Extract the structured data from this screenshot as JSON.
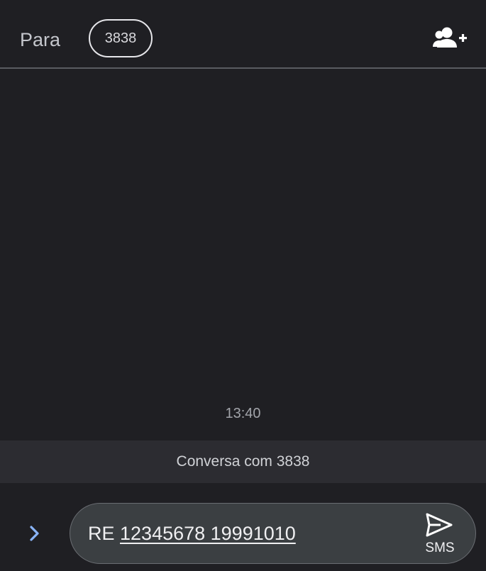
{
  "header": {
    "to_label": "Para",
    "recipient": "3838",
    "add_contact_icon": "person-add-icon"
  },
  "thread": {
    "timestamp": "13:40",
    "conversation_banner": "Conversa com 3838"
  },
  "composer": {
    "expand_icon": "chevron-right-icon",
    "text_prefix": "RE ",
    "text_underlined": "12345678 19991010",
    "send_icon": "send-icon",
    "send_label": "SMS"
  },
  "colors": {
    "background": "#1f1f23",
    "banner": "#2c2c31",
    "compose_box": "#3b3f42",
    "accent": "#8ab4f8"
  }
}
